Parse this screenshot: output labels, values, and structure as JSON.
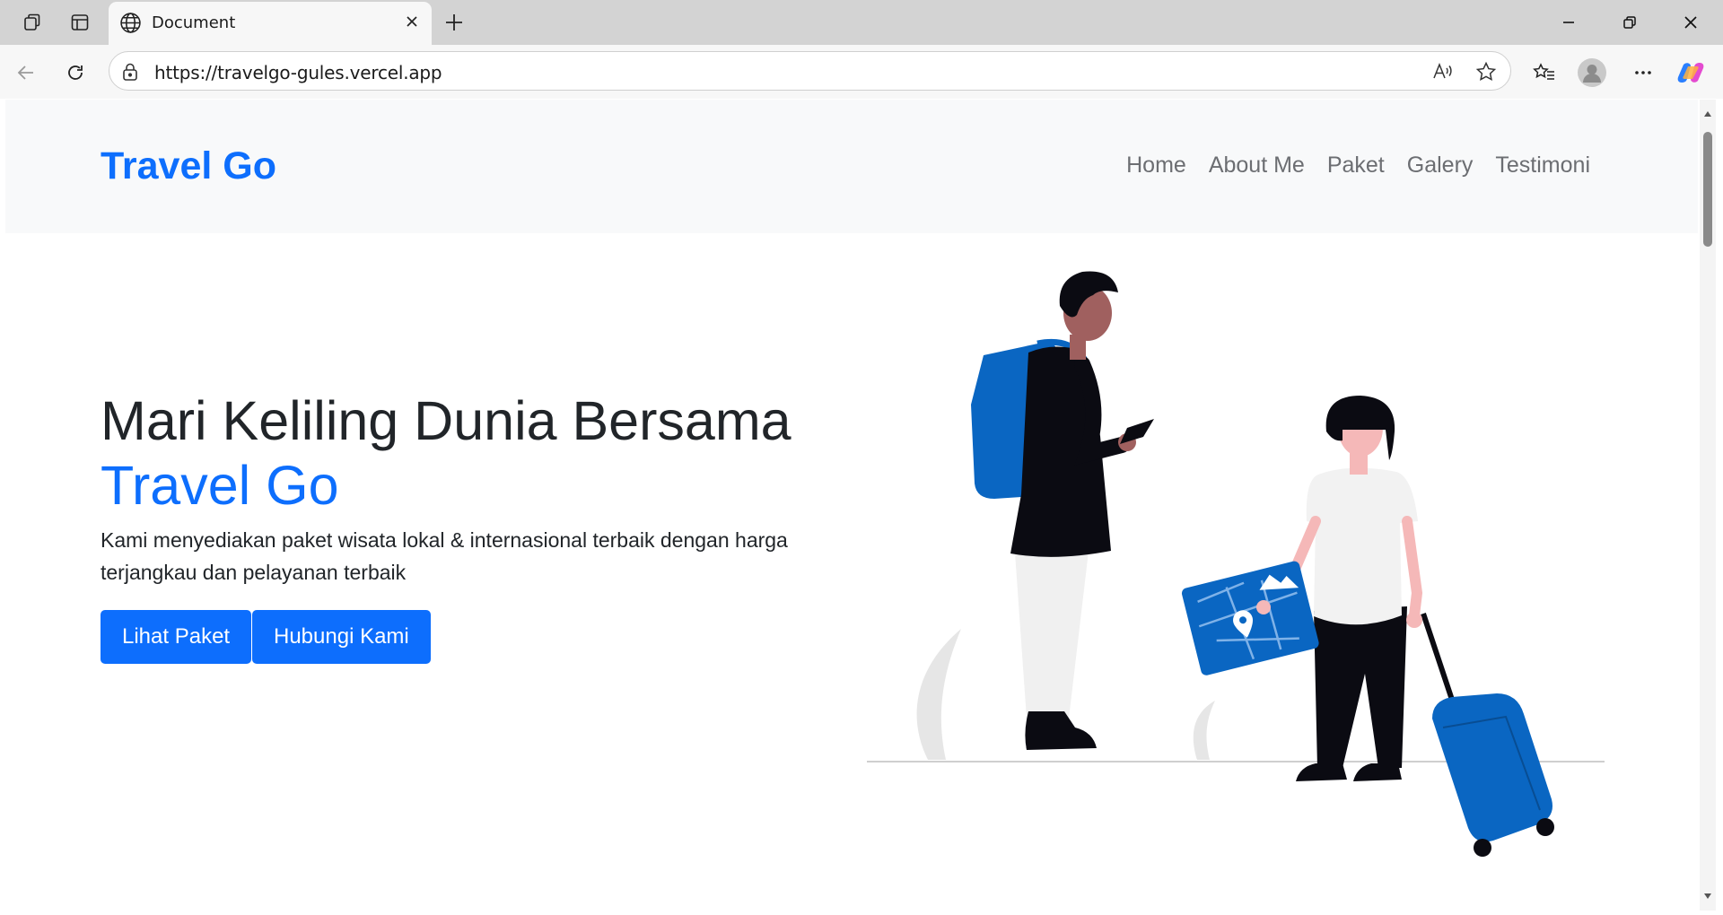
{
  "browser": {
    "tab_title": "Document",
    "url": "https://travelgo-gules.vercel.app"
  },
  "page": {
    "brand": "Travel Go",
    "nav": [
      "Home",
      "About Me",
      "Paket",
      "Galery",
      "Testimoni"
    ],
    "hero": {
      "title": "Mari Keliling Dunia Bersama",
      "title_highlight": "Travel Go",
      "description": "Kami menyediakan paket wisata lokal & internasional terbaik dengan harga terjangkau dan pelayanan terbaik",
      "primary_button": "Lihat Paket",
      "secondary_button": "Hubungi Kami"
    }
  },
  "colors": {
    "brand_blue": "#0d6efd",
    "navbar_bg": "#f8f9fa",
    "text_dark": "#212529",
    "nav_link": "#6c6e72",
    "illustration_blue": "#0a66c2"
  },
  "icons": [
    "tab-actions-icon",
    "tab-strip-icon",
    "globe-icon",
    "close-icon",
    "new-tab-icon",
    "minimize-icon",
    "restore-icon",
    "window-close-icon",
    "back-icon",
    "refresh-icon",
    "lock-icon",
    "read-aloud-icon",
    "favorite-star-icon",
    "favorites-icon",
    "profile-icon",
    "more-icon",
    "copilot-icon"
  ]
}
